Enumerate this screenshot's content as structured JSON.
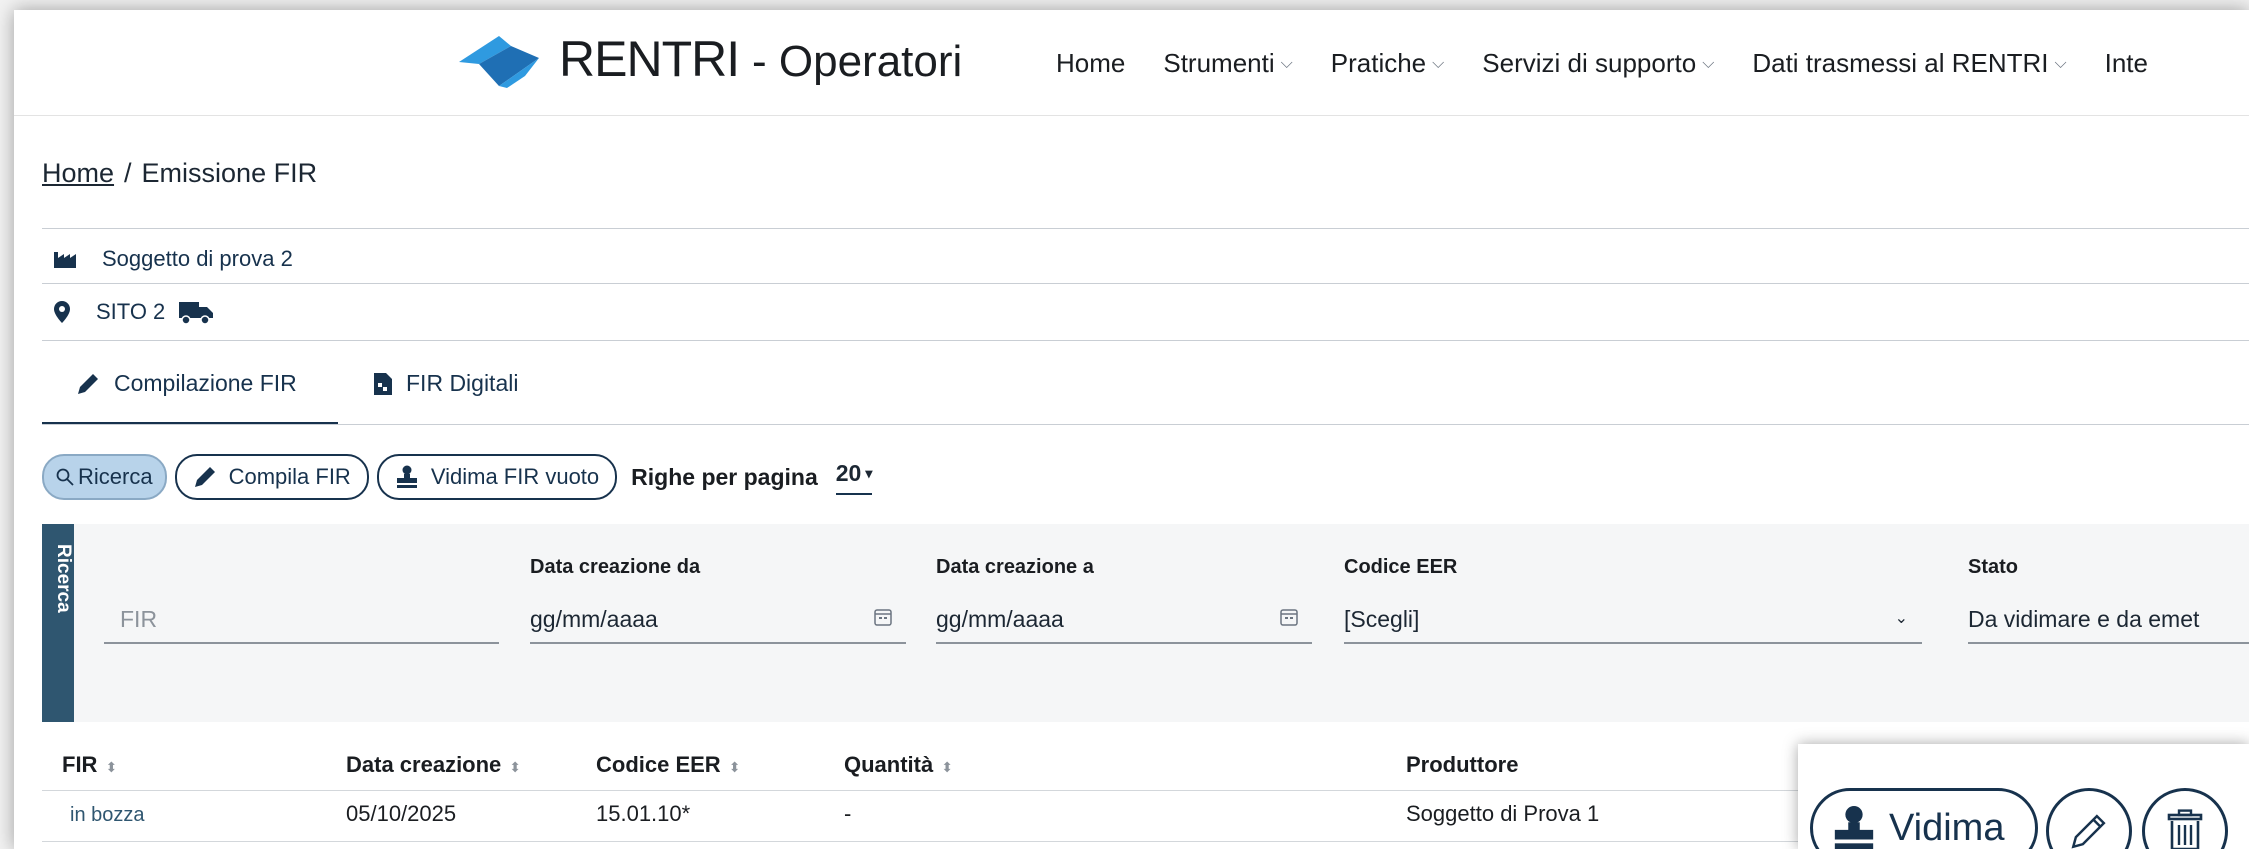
{
  "header": {
    "brand": "RENTRI",
    "brand_suffix": "- Operatori",
    "nav": [
      {
        "label": "Home",
        "chevron": false
      },
      {
        "label": "Strumenti",
        "chevron": true
      },
      {
        "label": "Pratiche",
        "chevron": true
      },
      {
        "label": "Servizi di supporto",
        "chevron": true
      },
      {
        "label": "Dati trasmessi al RENTRI",
        "chevron": true
      },
      {
        "label": "Inte",
        "chevron": false
      }
    ]
  },
  "breadcrumb": {
    "home": "Home",
    "separator": "/",
    "current": "Emissione FIR"
  },
  "context": {
    "soggetto": "Soggetto di prova 2",
    "sito": "SITO 2"
  },
  "tabs": [
    {
      "label": "Compilazione FIR",
      "icon": "pencil-icon",
      "active": true
    },
    {
      "label": "FIR Digitali",
      "icon": "digital-file-icon",
      "active": false
    }
  ],
  "toolbar": {
    "ricerca": "Ricerca",
    "compila": "Compila FIR",
    "vidima_vuoto": "Vidima FIR vuoto",
    "righe_label": "Righe per pagina",
    "righe_value": "20"
  },
  "search": {
    "panel_label": "Ricerca",
    "fir_placeholder": "FIR",
    "data_da_label": "Data creazione da",
    "data_da_value": "gg/mm/aaaa",
    "data_a_label": "Data creazione a",
    "data_a_value": "gg/mm/aaaa",
    "eer_label": "Codice EER",
    "eer_value": "[Scegli]",
    "stato_label": "Stato",
    "stato_value": "Da vidimare e da emet"
  },
  "table": {
    "columns": [
      "FIR",
      "Data creazione",
      "Codice EER",
      "Quantità",
      "Produttore"
    ],
    "rows": [
      {
        "fir": "in bozza",
        "data": "05/10/2025",
        "eer": "15.01.10*",
        "quantita": "-",
        "produttore": "Soggetto di Prova 1"
      }
    ]
  },
  "row_actions": {
    "vidima": "Vidima"
  },
  "colors": {
    "primary": "#17324d",
    "accent": "#2f9ae0",
    "panel": "#2f5670",
    "active_pill": "#b8d3ea"
  }
}
